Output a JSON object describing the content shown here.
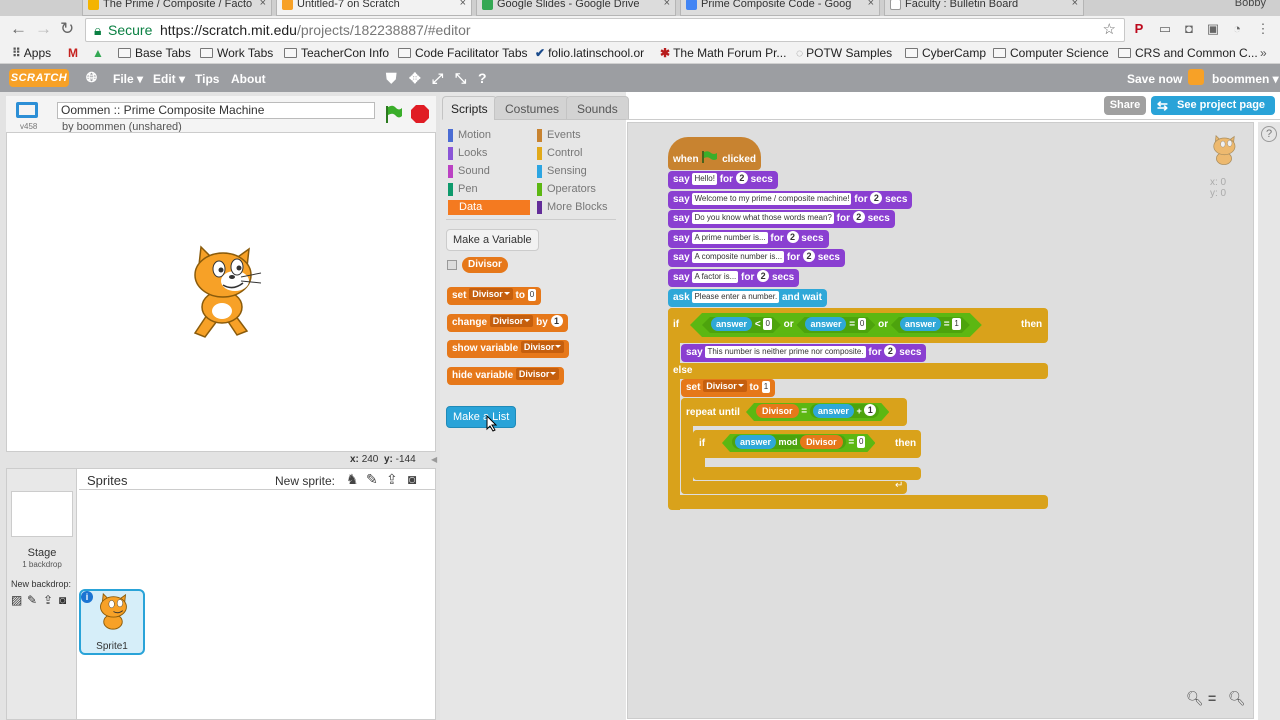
{
  "browser": {
    "tabs": [
      "The Prime / Composite / Facto",
      "Untitled-7 on Scratch",
      "Google Slides - Google Drive",
      "Prime Composite Code - Goog",
      "Faculty : Bulletin Board"
    ],
    "user": "Bobby",
    "secure_label": "Secure",
    "url_base": "https://scratch.mit.edu",
    "url_path": "/projects/182238887/#editor",
    "bookmarks": [
      "Apps",
      "Base Tabs",
      "Work Tabs",
      "TeacherCon Info",
      "Code Facilitator Tabs",
      "folio.latinschool.or",
      "The Math Forum Pr...",
      "POTW Samples",
      "CyberCamp",
      "Computer Science",
      "CRS and Common C..."
    ]
  },
  "menubar": {
    "logo": "SCRATCH",
    "items": [
      "File ▾",
      "Edit ▾",
      "Tips",
      "About"
    ],
    "save": "Save now",
    "user": "boommen ▾"
  },
  "project": {
    "version": "v458",
    "title": "Oommen :: Prime Composite Machine",
    "byline": "by boommen (unshared)",
    "share": "Share",
    "see_page": "See project page"
  },
  "stage": {
    "x_label": "x:",
    "x": "240",
    "y_label": "y:",
    "y": "-144"
  },
  "sprites": {
    "header": "Sprites",
    "new_sprite": "New sprite:",
    "stage_label": "Stage",
    "stage_sub": "1 backdrop",
    "new_backdrop": "New backdrop:",
    "sprite_name": "Sprite1",
    "info": "i"
  },
  "tabs": [
    "Scripts",
    "Costumes",
    "Sounds"
  ],
  "categories": [
    {
      "name": "Motion",
      "color": "#4a6cd4"
    },
    {
      "name": "Events",
      "color": "#c88330"
    },
    {
      "name": "Looks",
      "color": "#8a55d7"
    },
    {
      "name": "Control",
      "color": "#e1a91a"
    },
    {
      "name": "Sound",
      "color": "#bb42c3"
    },
    {
      "name": "Sensing",
      "color": "#2ca5e2"
    },
    {
      "name": "Pen",
      "color": "#0e9a6c"
    },
    {
      "name": "Operators",
      "color": "#5cb712"
    },
    {
      "name": "Data",
      "color": "#ee7d16"
    },
    {
      "name": "More Blocks",
      "color": "#632d99"
    }
  ],
  "palette": {
    "make_variable": "Make a Variable",
    "variable": "Divisor",
    "set": "set",
    "to": "to",
    "set_val": "0",
    "change": "change",
    "by": "by",
    "change_val": "1",
    "show": "show variable",
    "hide": "hide variable",
    "make_list": "Make a List"
  },
  "script": {
    "when": "when",
    "clicked": "clicked",
    "say": "say",
    "for": "for",
    "secs": "secs",
    "say_msgs": [
      "Hello!",
      "Welcome to my prime / composite machine!",
      "Do you know what those words mean?",
      "A prime number is...",
      "A composite number is...",
      "A factor is..."
    ],
    "two": "2",
    "ask": "ask",
    "ask_text": "Please enter a number.",
    "and_wait": "and wait",
    "if": "if",
    "then": "then",
    "else": "else",
    "or": "or",
    "answer": "answer",
    "lt": "<",
    "eq": "=",
    "zero": "0",
    "one": "1",
    "neither": "This number is neither prime nor composite.",
    "set": "set",
    "divisor": "Divisor",
    "to": "to",
    "repeat_until": "repeat until",
    "plus": "+",
    "mod": "mod"
  },
  "sprite_corner": {
    "x": "x: 0",
    "y": "y: 0"
  }
}
